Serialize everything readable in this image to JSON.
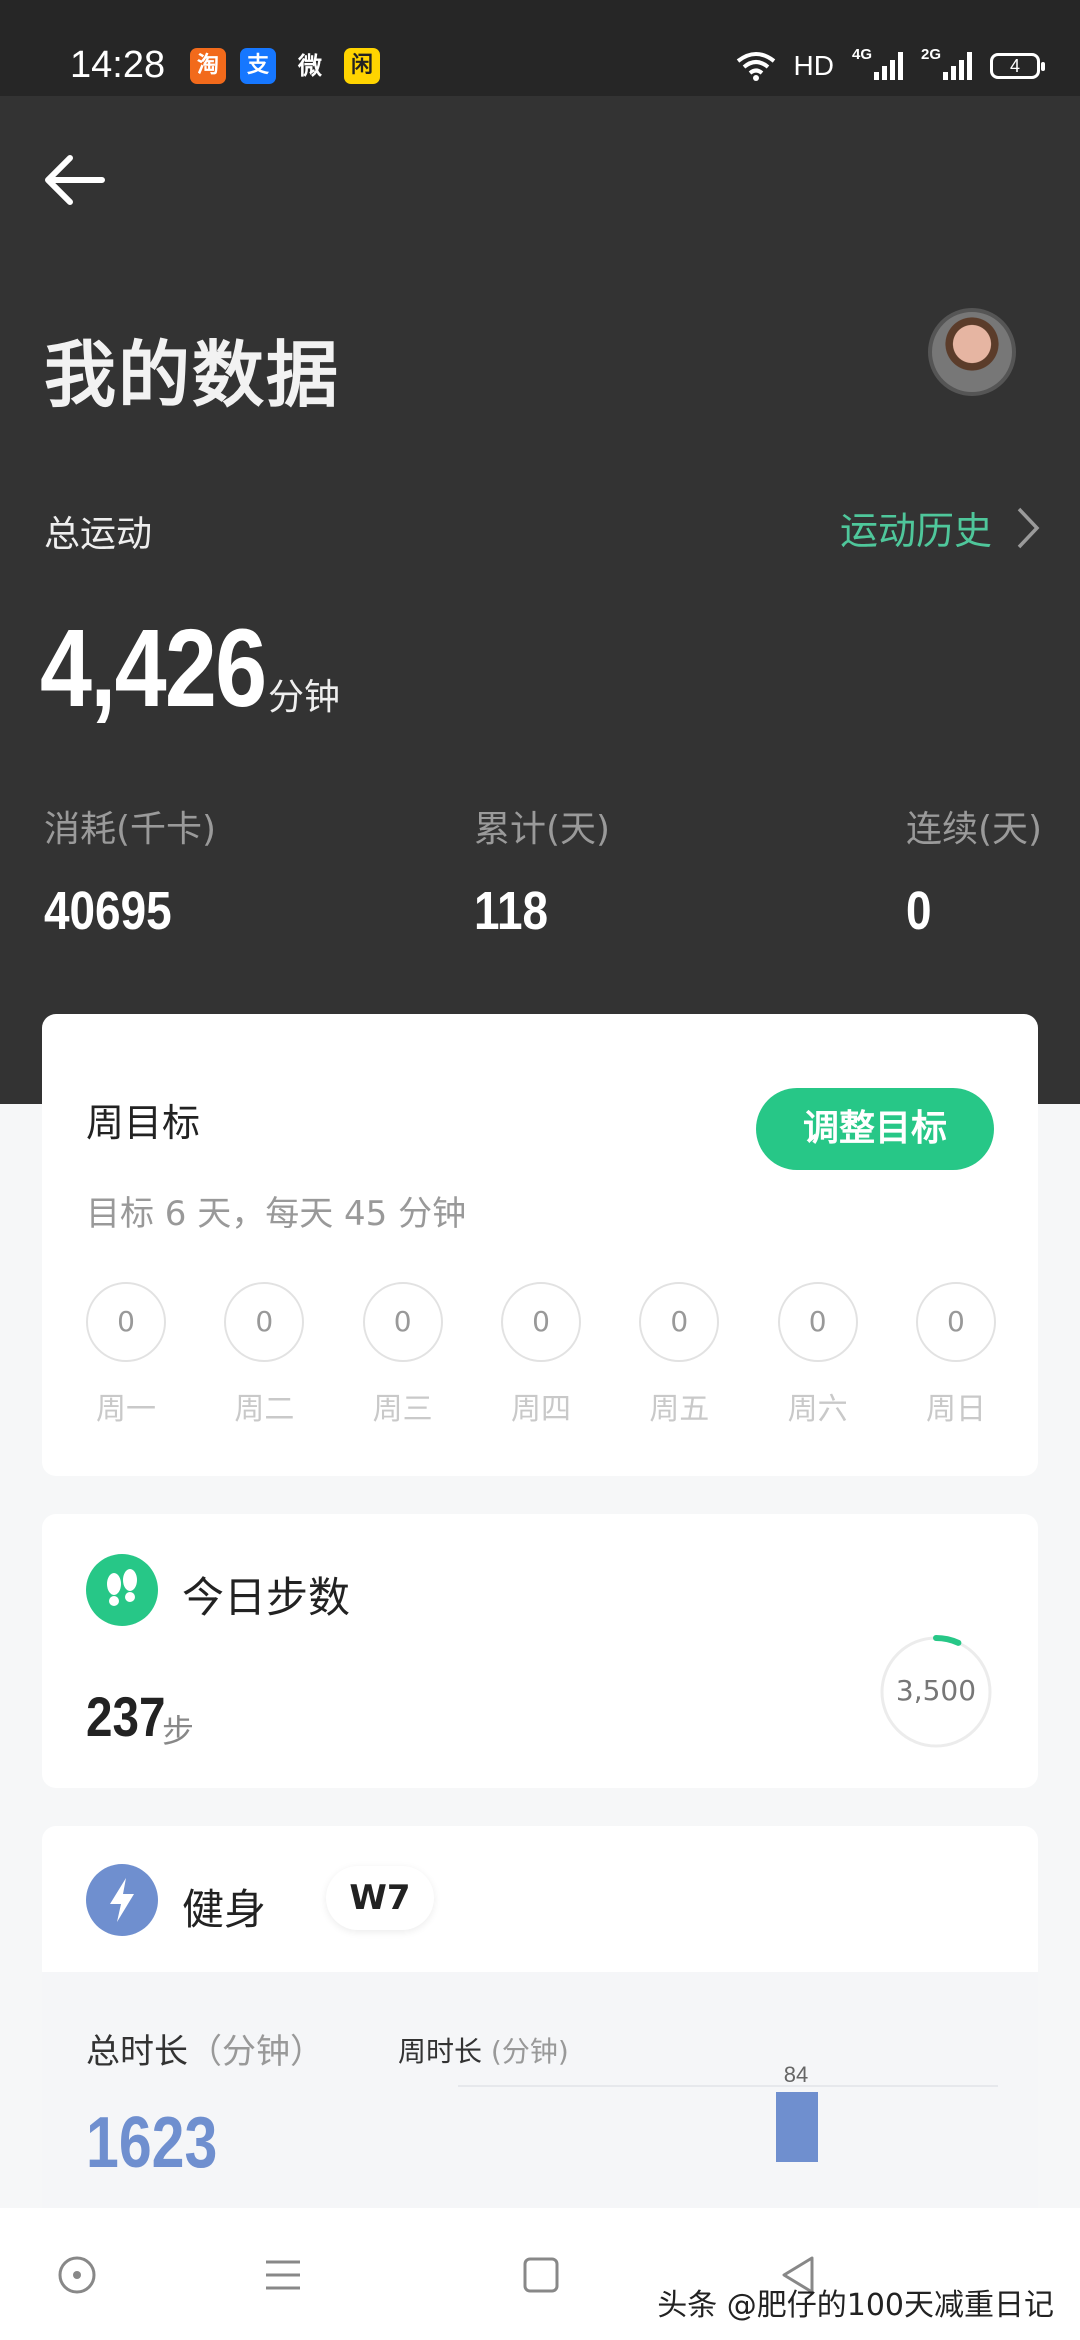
{
  "status_bar": {
    "time": "14:28",
    "apps": [
      "淘",
      "支",
      "微",
      "闲"
    ],
    "network": "HD",
    "sig1": "4G",
    "sig2": "2G",
    "battery": "4"
  },
  "header": {
    "title": "我的数据"
  },
  "summary": {
    "label": "总运动",
    "history_link": "运动历史",
    "total_minutes": "4,426",
    "unit": "分钟",
    "stats": [
      {
        "label": "消耗(千卡)",
        "value": "40695"
      },
      {
        "label": "累计(天)",
        "value": "118"
      },
      {
        "label": "连续(天)",
        "value": "0"
      }
    ]
  },
  "weekly_goal": {
    "title": "周目标",
    "adjust_button": "调整目标",
    "subtitle": "目标 6 天，每天 45 分钟",
    "days": [
      {
        "label": "周一",
        "value": "0"
      },
      {
        "label": "周二",
        "value": "0"
      },
      {
        "label": "周三",
        "value": "0"
      },
      {
        "label": "周四",
        "value": "0"
      },
      {
        "label": "周五",
        "value": "0"
      },
      {
        "label": "周六",
        "value": "0"
      },
      {
        "label": "周日",
        "value": "0"
      }
    ]
  },
  "steps": {
    "title": "今日步数",
    "value": "237",
    "unit": "步",
    "goal": "3,500",
    "progress": 0.068
  },
  "fitness": {
    "title": "健身",
    "badge": "W7",
    "total_label": "总时长",
    "total_unit": "（分钟）",
    "total_value": "1623",
    "week_label": "周时长",
    "week_unit": "(分钟)",
    "week_bar_value": "84"
  },
  "watermark": "头条 @肥仔的100天减重日记",
  "colors": {
    "accent_green": "#27c787",
    "link_green": "#4fc79b",
    "fitness_blue": "#6f8fcf",
    "hero_bg": "#333333"
  }
}
